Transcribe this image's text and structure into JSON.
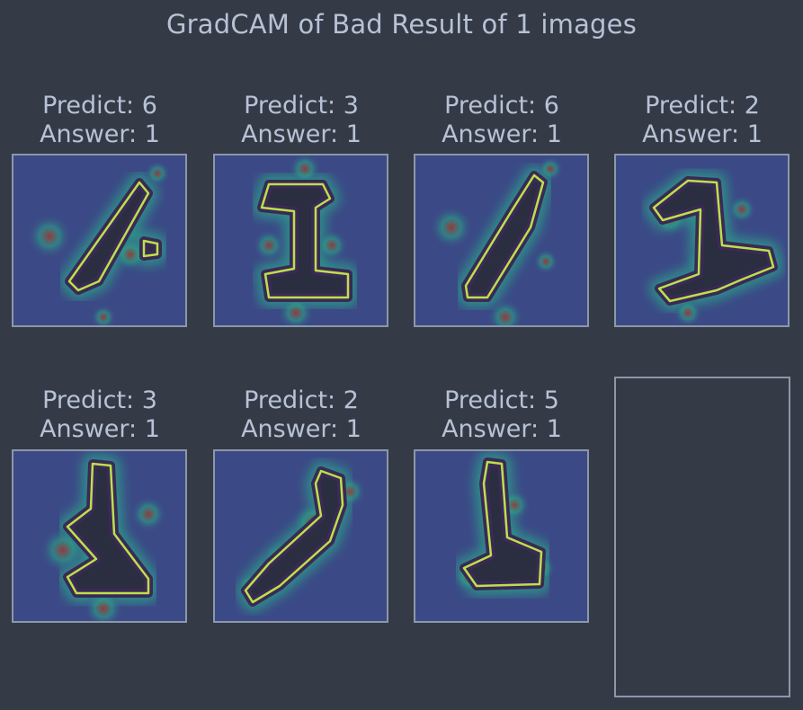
{
  "title": "GradCAM of Bad Result of 1 images",
  "panels": [
    {
      "predict": "Predict: 6",
      "answer": "Answer: 1",
      "shape": "slant-6"
    },
    {
      "predict": "Predict: 3",
      "answer": "Answer: 1",
      "shape": "block-1"
    },
    {
      "predict": "Predict: 6",
      "answer": "Answer: 1",
      "shape": "slant-thin"
    },
    {
      "predict": "Predict: 2",
      "answer": "Answer: 1",
      "shape": "one-foot-right"
    },
    {
      "predict": "Predict: 3",
      "answer": "Answer: 1",
      "shape": "one-foot-left"
    },
    {
      "predict": "Predict: 2",
      "answer": "Answer: 1",
      "shape": "diagonal-stroke"
    },
    {
      "predict": "Predict: 5",
      "answer": "Answer: 1",
      "shape": "one-base"
    }
  ],
  "colors": {
    "background": "#343b46",
    "text": "#b8c2d6",
    "frame": "#8c97aa",
    "heat_low": "#3b4a86",
    "heat_mid": "#2aa38a",
    "heat_high": "#a5352b",
    "contour": "#bde04a"
  }
}
